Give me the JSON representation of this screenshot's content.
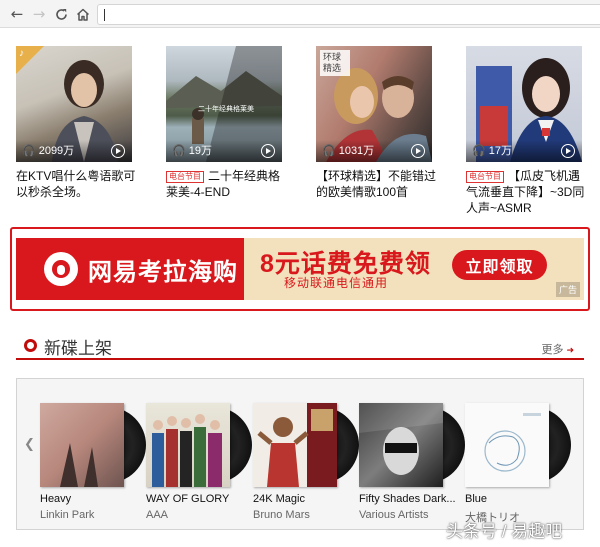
{
  "browser": {
    "back_icon": "back-arrow-icon",
    "forward_icon": "forward-arrow-icon",
    "reload_icon": "reload-icon",
    "home_icon": "home-icon",
    "url": ""
  },
  "playlists": [
    {
      "plays": "2099万",
      "title": "在KTV唱什么粤语歌可以秒杀全场。",
      "tag": ""
    },
    {
      "plays": "19万",
      "title": "二十年经典格莱美-4-END",
      "tag": "电台节目",
      "overlay": "二十年经典格莱美"
    },
    {
      "plays": "1031万",
      "title": "【环球精选】不能错过的欧美情歌100首",
      "tag": "",
      "label": "环球精选"
    },
    {
      "plays": "17万",
      "title": "【瓜皮飞机遇气流垂直下降】~3D同人声~ASMR",
      "tag": "电台节目"
    }
  ],
  "banner": {
    "brand": "网易考拉海购",
    "headline": "8元话费免费领",
    "subline": "移动联通电信通用",
    "cta": "立即领取",
    "ad_label": "广告"
  },
  "section": {
    "title": "新碟上架",
    "more": "更多"
  },
  "albums": [
    {
      "name": "Heavy",
      "artist": "Linkin Park"
    },
    {
      "name": "WAY OF GLORY",
      "artist": "AAA"
    },
    {
      "name": "24K Magic",
      "artist": "Bruno Mars"
    },
    {
      "name": "Fifty Shades Dark...",
      "artist": "Various Artists"
    },
    {
      "name": "Blue",
      "artist": "大橋トリオ"
    }
  ],
  "watermark": "头条号 / 易趣吧",
  "colors": {
    "accent": "#c20c0c",
    "banner_red": "#d8181c",
    "banner_cream": "#f3e1bd"
  }
}
